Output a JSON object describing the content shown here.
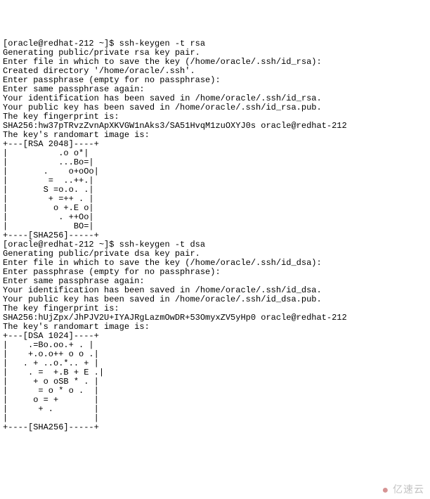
{
  "terminal": {
    "lines": [
      "[oracle@redhat-212 ~]$ ssh-keygen -t rsa",
      "Generating public/private rsa key pair.",
      "Enter file in which to save the key (/home/oracle/.ssh/id_rsa):",
      "Created directory '/home/oracle/.ssh'.",
      "Enter passphrase (empty for no passphrase):",
      "Enter same passphrase again:",
      "Your identification has been saved in /home/oracle/.ssh/id_rsa.",
      "Your public key has been saved in /home/oracle/.ssh/id_rsa.pub.",
      "The key fingerprint is:",
      "SHA256:hw37pTRvzZvnApXKVGW1nAks3/SA51HvqM1zuOXYJ0s oracle@redhat-212",
      "The key's randomart image is:",
      "+---[RSA 2048]----+",
      "|          .o o*|",
      "|          ...Bo=|",
      "|       .    o+oOo|",
      "|        =  ..++.|",
      "|       S =o.o. .|",
      "|        + =++ . |",
      "|         o +.E o|",
      "|          . ++Oo|",
      "|             BO=|",
      "+----[SHA256]-----+",
      "[oracle@redhat-212 ~]$ ssh-keygen -t dsa",
      "Generating public/private dsa key pair.",
      "Enter file in which to save the key (/home/oracle/.ssh/id_dsa):",
      "Enter passphrase (empty for no passphrase):",
      "Enter same passphrase again:",
      "Your identification has been saved in /home/oracle/.ssh/id_dsa.",
      "Your public key has been saved in /home/oracle/.ssh/id_dsa.pub.",
      "The key fingerprint is:",
      "SHA256:hUjZpx/JhPJV2U+IYAJRgLazmOwDR+53OmyxZV5yHp0 oracle@redhat-212",
      "The key's randomart image is:",
      "+---[DSA 1024]----+",
      "|    .=Bo.oo.+ . |",
      "|    +.o.o++ o o .|",
      "|   . + ..o.*.. + |",
      "|    . =  +.B + E .|",
      "|     + o oSB * . |",
      "|      = o * o .  |",
      "|     o = +       |",
      "|      + .        |",
      "|                 |",
      "+----[SHA256]-----+"
    ]
  },
  "watermark": {
    "text": "亿速云"
  }
}
